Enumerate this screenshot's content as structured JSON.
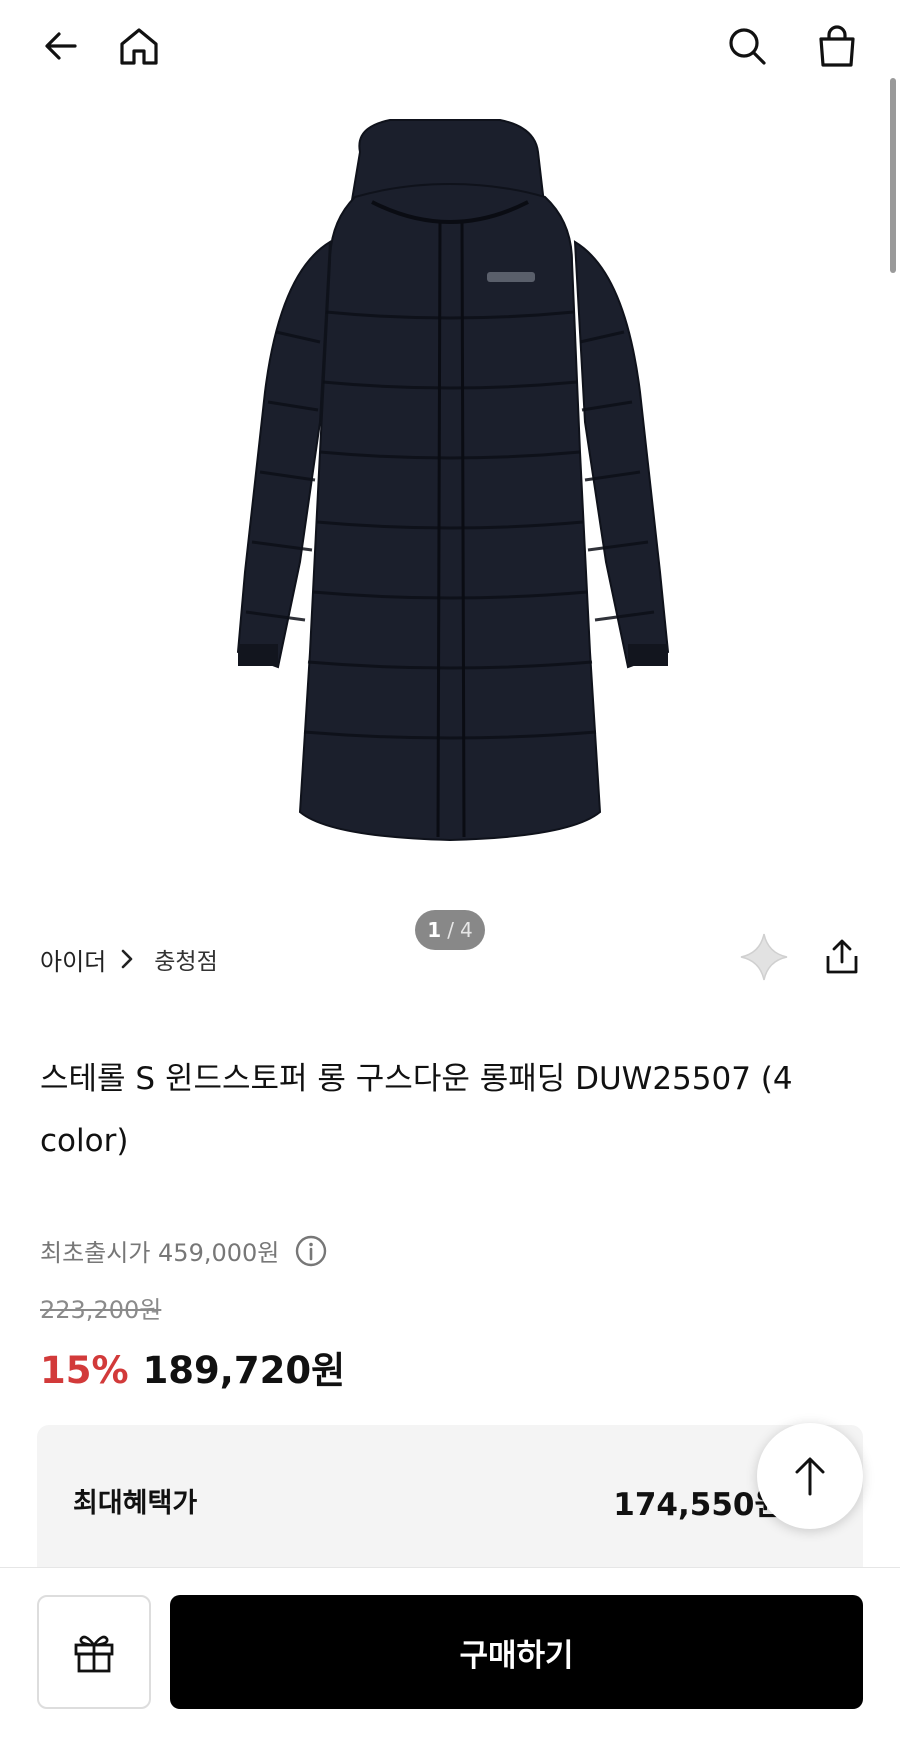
{
  "topbar": {
    "back_icon": "arrow-left-icon",
    "home_icon": "home-icon",
    "search_icon": "search-icon",
    "bag_icon": "shopping-bag-icon"
  },
  "gallery": {
    "current": "1",
    "separator": "/",
    "total": "4",
    "image_subject": "navy long down parka"
  },
  "product": {
    "brand": "아이더",
    "store": "충청점",
    "title": "스테롤 S 윈드스토퍼 롱 구스다운 롱패딩 DUW25507 (4 color)",
    "original_price_label": "최초출시가 459,000원",
    "list_price": "223,200원",
    "discount": "15%",
    "sale_price": "189,720원"
  },
  "benefit": {
    "label": "최대혜택가",
    "price": "174,550원"
  },
  "bottom": {
    "buy_label": "구매하기"
  },
  "colors": {
    "accent_red": "#d23a3a",
    "buy_button": "#000000",
    "benefit_bg": "#f4f4f4",
    "jacket": "#1b1f2c"
  }
}
